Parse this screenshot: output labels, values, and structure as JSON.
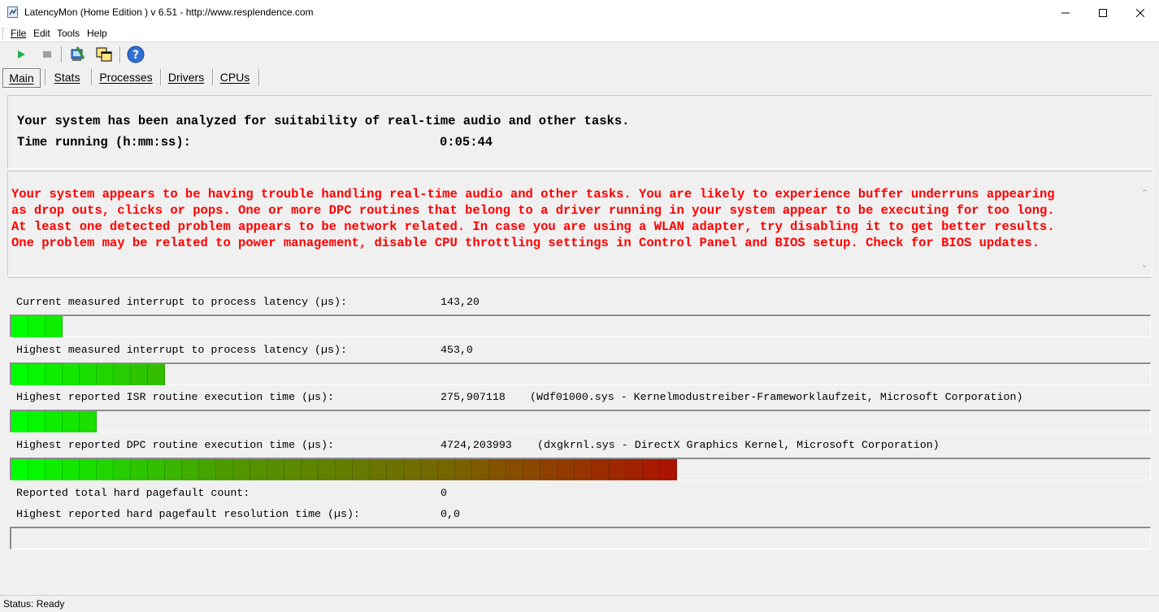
{
  "window": {
    "title": "LatencyMon  (Home Edition )  v 6.51 - http://www.resplendence.com"
  },
  "menu": [
    "File",
    "Edit",
    "Tools",
    "Help"
  ],
  "toolbar": {
    "buttons": [
      "play-icon",
      "stop-icon",
      "kernel-timer-icon",
      "windows-icon",
      "help-icon"
    ]
  },
  "tabs": [
    "Main",
    "Stats",
    "Processes",
    "Drivers",
    "CPUs"
  ],
  "summary": {
    "line1": "Your system has been analyzed for suitability of real-time audio and other tasks.",
    "time_label": "Time running (h:mm:ss):",
    "time_value": "0:05:44"
  },
  "warning": {
    "lines": [
      "Your system appears to be having trouble handling real-time audio and other tasks. You are likely to experience buffer underruns appearing",
      "as drop outs, clicks or pops. One or more DPC routines that belong to a driver running in your system appear to be executing for too long.",
      "At least one detected problem appears to be network related. In case you are using a WLAN adapter, try disabling it to get better results.",
      "One problem may be related to power management, disable CPU throttling settings in Control Panel and BIOS setup. Check for BIOS updates."
    ],
    "color": "#ff0000"
  },
  "metrics": [
    {
      "label": "Current measured interrupt to process latency (µs):",
      "value": "143,20",
      "detail": "",
      "bar_segments": 3
    },
    {
      "label": "Highest measured interrupt to process latency (µs):",
      "value": "453,0",
      "detail": "",
      "bar_segments": 9
    },
    {
      "label": "Highest reported ISR routine execution time (µs):",
      "value": "275,907118",
      "detail": "(Wdf01000.sys - Kernelmodustreiber-Frameworklaufzeit, Microsoft Corporation)",
      "bar_segments": 5
    },
    {
      "label": "Highest reported DPC routine execution time (µs):",
      "value": "4724,203993",
      "detail": "(dxgkrnl.sys - DirectX Graphics Kernel, Microsoft Corporation)",
      "bar_segments": 39
    },
    {
      "label": "Reported total hard pagefault count:",
      "value": "0",
      "detail": ""
    },
    {
      "label": "Highest reported hard pagefault resolution time (µs):",
      "value": "0,0",
      "detail": "",
      "bar_segments": 0
    }
  ],
  "status": {
    "text": "Status: Ready"
  }
}
